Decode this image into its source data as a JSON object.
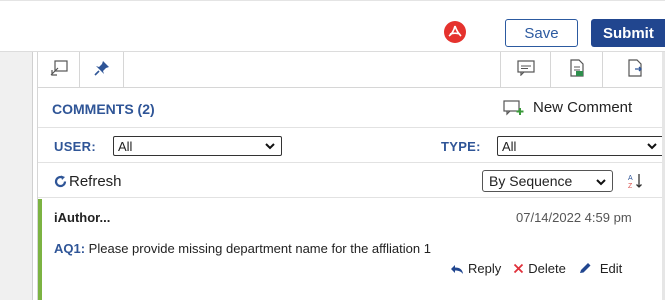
{
  "toolbar": {
    "pdf_icon": "pdf-icon",
    "save_label": "Save",
    "submit_label": "Submit",
    "colors": {
      "accent": "#21468f",
      "pdf": "#e5322d"
    }
  },
  "tabs": {
    "left": [
      "collapse-panel-icon",
      "pin-icon"
    ],
    "right": [
      "comments-icon",
      "document-icon",
      "export-icon"
    ]
  },
  "comments": {
    "title": "COMMENTS (2)",
    "new_comment_label": "New Comment",
    "filters": {
      "user_label": "USER:",
      "user_value": "All",
      "type_label": "TYPE:",
      "type_value": "All"
    },
    "refresh_label": "Refresh",
    "sort_value": "By Sequence",
    "items": [
      {
        "author": "iAuthor...",
        "date": "07/14/2022 4:59 pm",
        "query_id": "AQ1:",
        "text": " Please provide missing department name for the affliation 1",
        "reply_label": "Reply",
        "delete_label": "Delete",
        "edit_label": "Edit",
        "status_color": "#7cb342"
      }
    ]
  }
}
